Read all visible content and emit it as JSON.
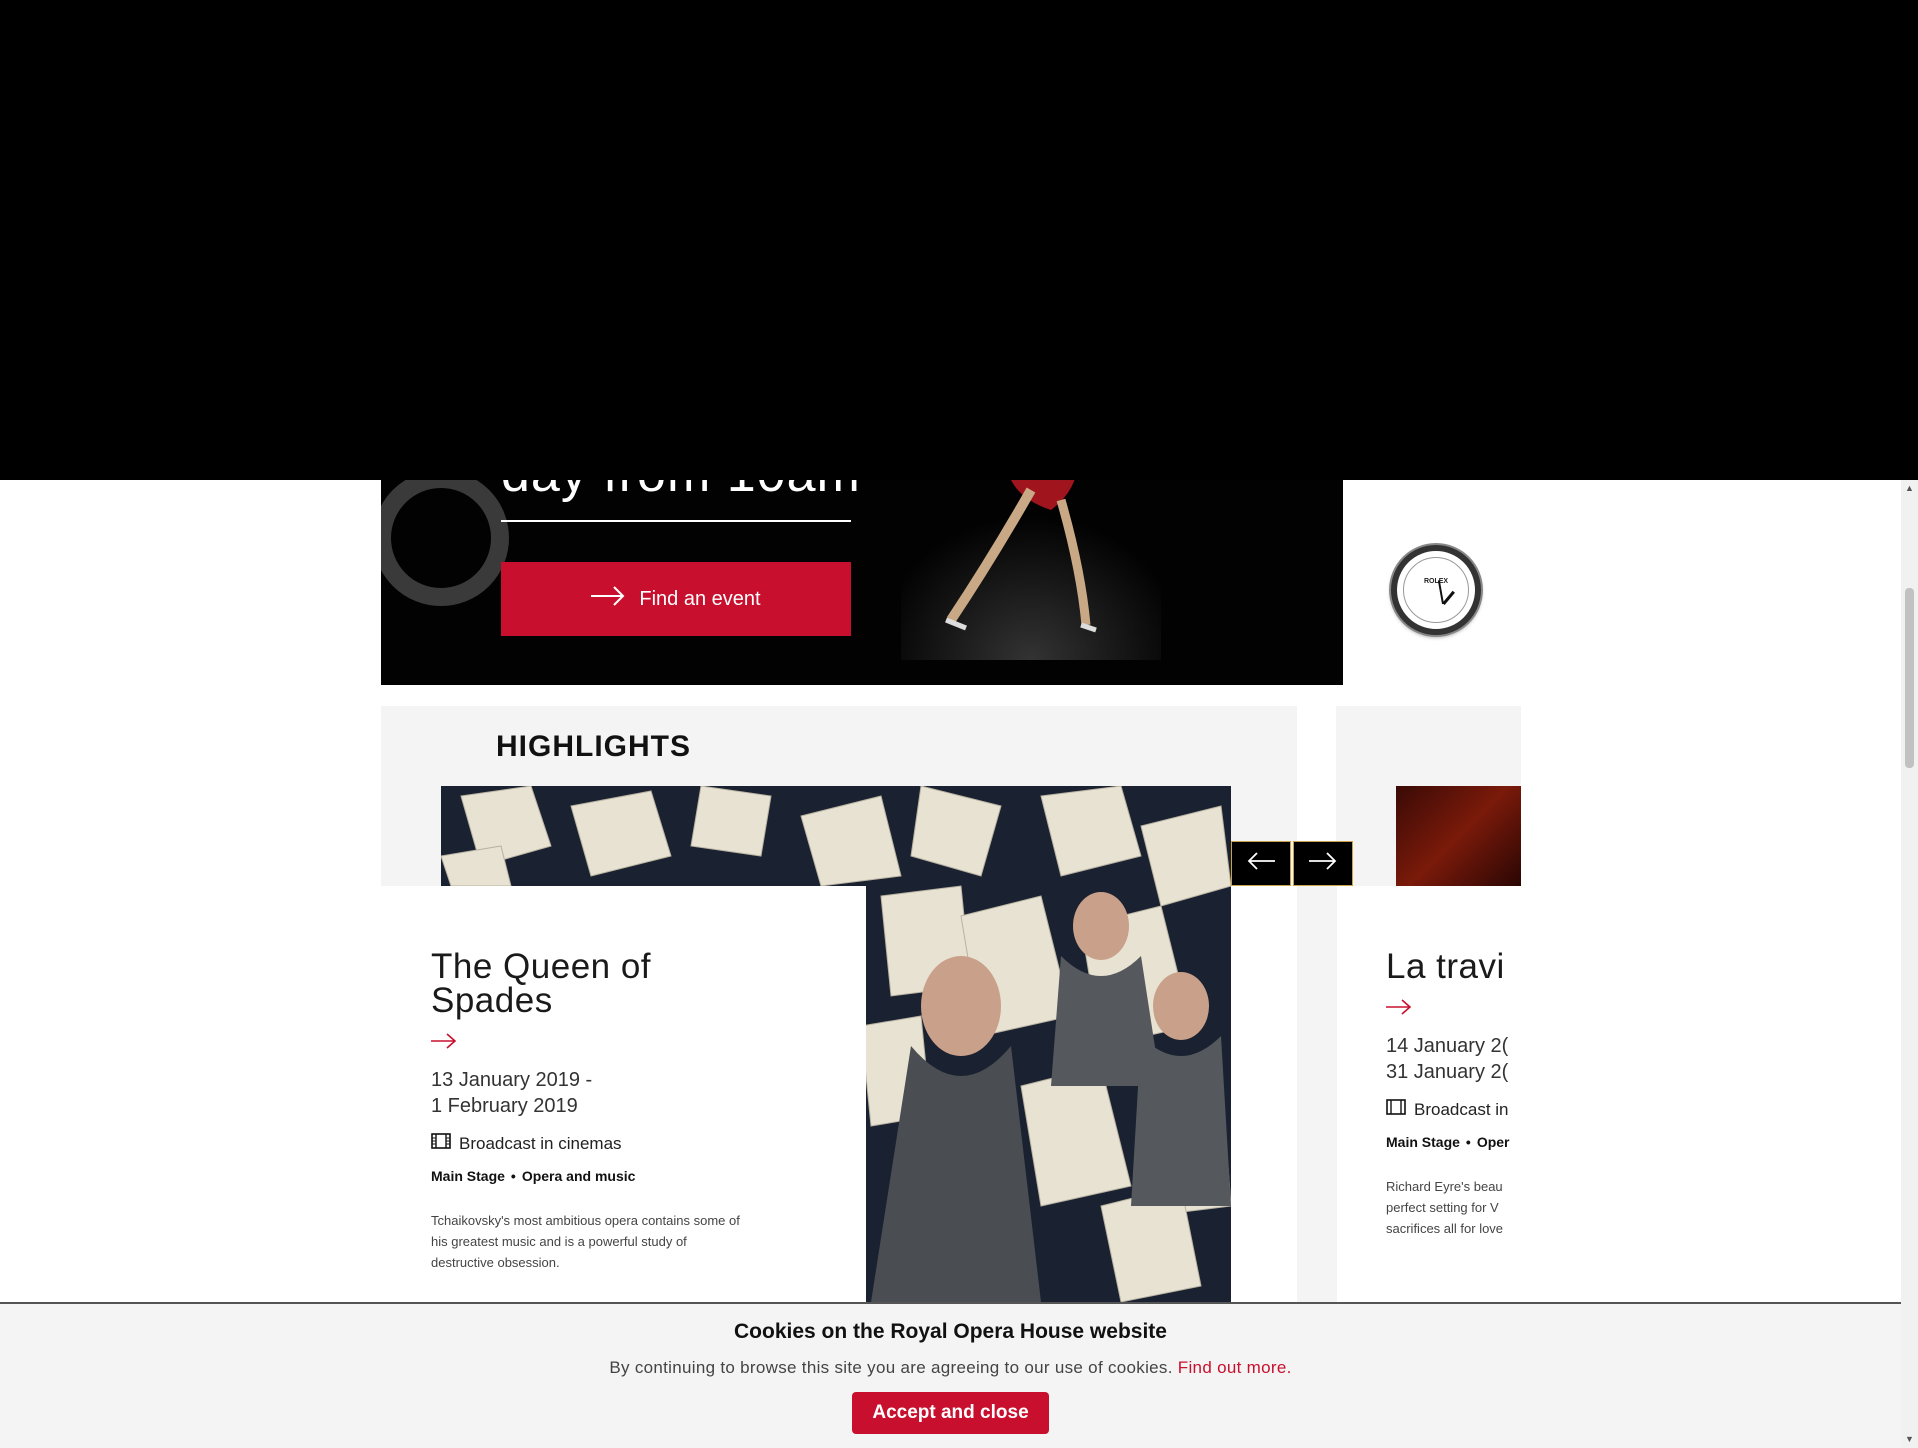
{
  "hero": {
    "heading_fragment": "day from 10am",
    "find_button_label": "Find an event"
  },
  "sponsor": {
    "clock_brand": "ROLEX"
  },
  "highlights": {
    "title": "HIGHLIGHTS",
    "cards": [
      {
        "title_line1": "The Queen of",
        "title_line2": "Spades",
        "date_line1": "13 January 2019 -",
        "date_line2": "1 February 2019",
        "broadcast": "Broadcast in cinemas",
        "venue": "Main Stage",
        "category": "Opera and music",
        "desc_line1": "Tchaikovsky's most ambitious opera contains some of",
        "desc_line2": "his greatest music and is a powerful study of",
        "desc_line3": "destructive obsession."
      },
      {
        "title_line1": "La travi",
        "date_line1": "14 January 2(",
        "date_line2": "31 January 2(",
        "broadcast": "Broadcast in",
        "venue": "Main Stage",
        "category": "Oper",
        "desc_line1": "Richard Eyre's beau",
        "desc_line2": "perfect setting for V",
        "desc_line3": "sacrifices all for love"
      }
    ]
  },
  "cookie": {
    "title": "Cookies on the Royal Opera House website",
    "text": "By continuing to browse this site you are agreeing to our use of cookies.",
    "link": "Find out more.",
    "button": "Accept and close"
  },
  "colors": {
    "brand_red": "#c8102e",
    "panel_grey": "#f4f4f4"
  }
}
